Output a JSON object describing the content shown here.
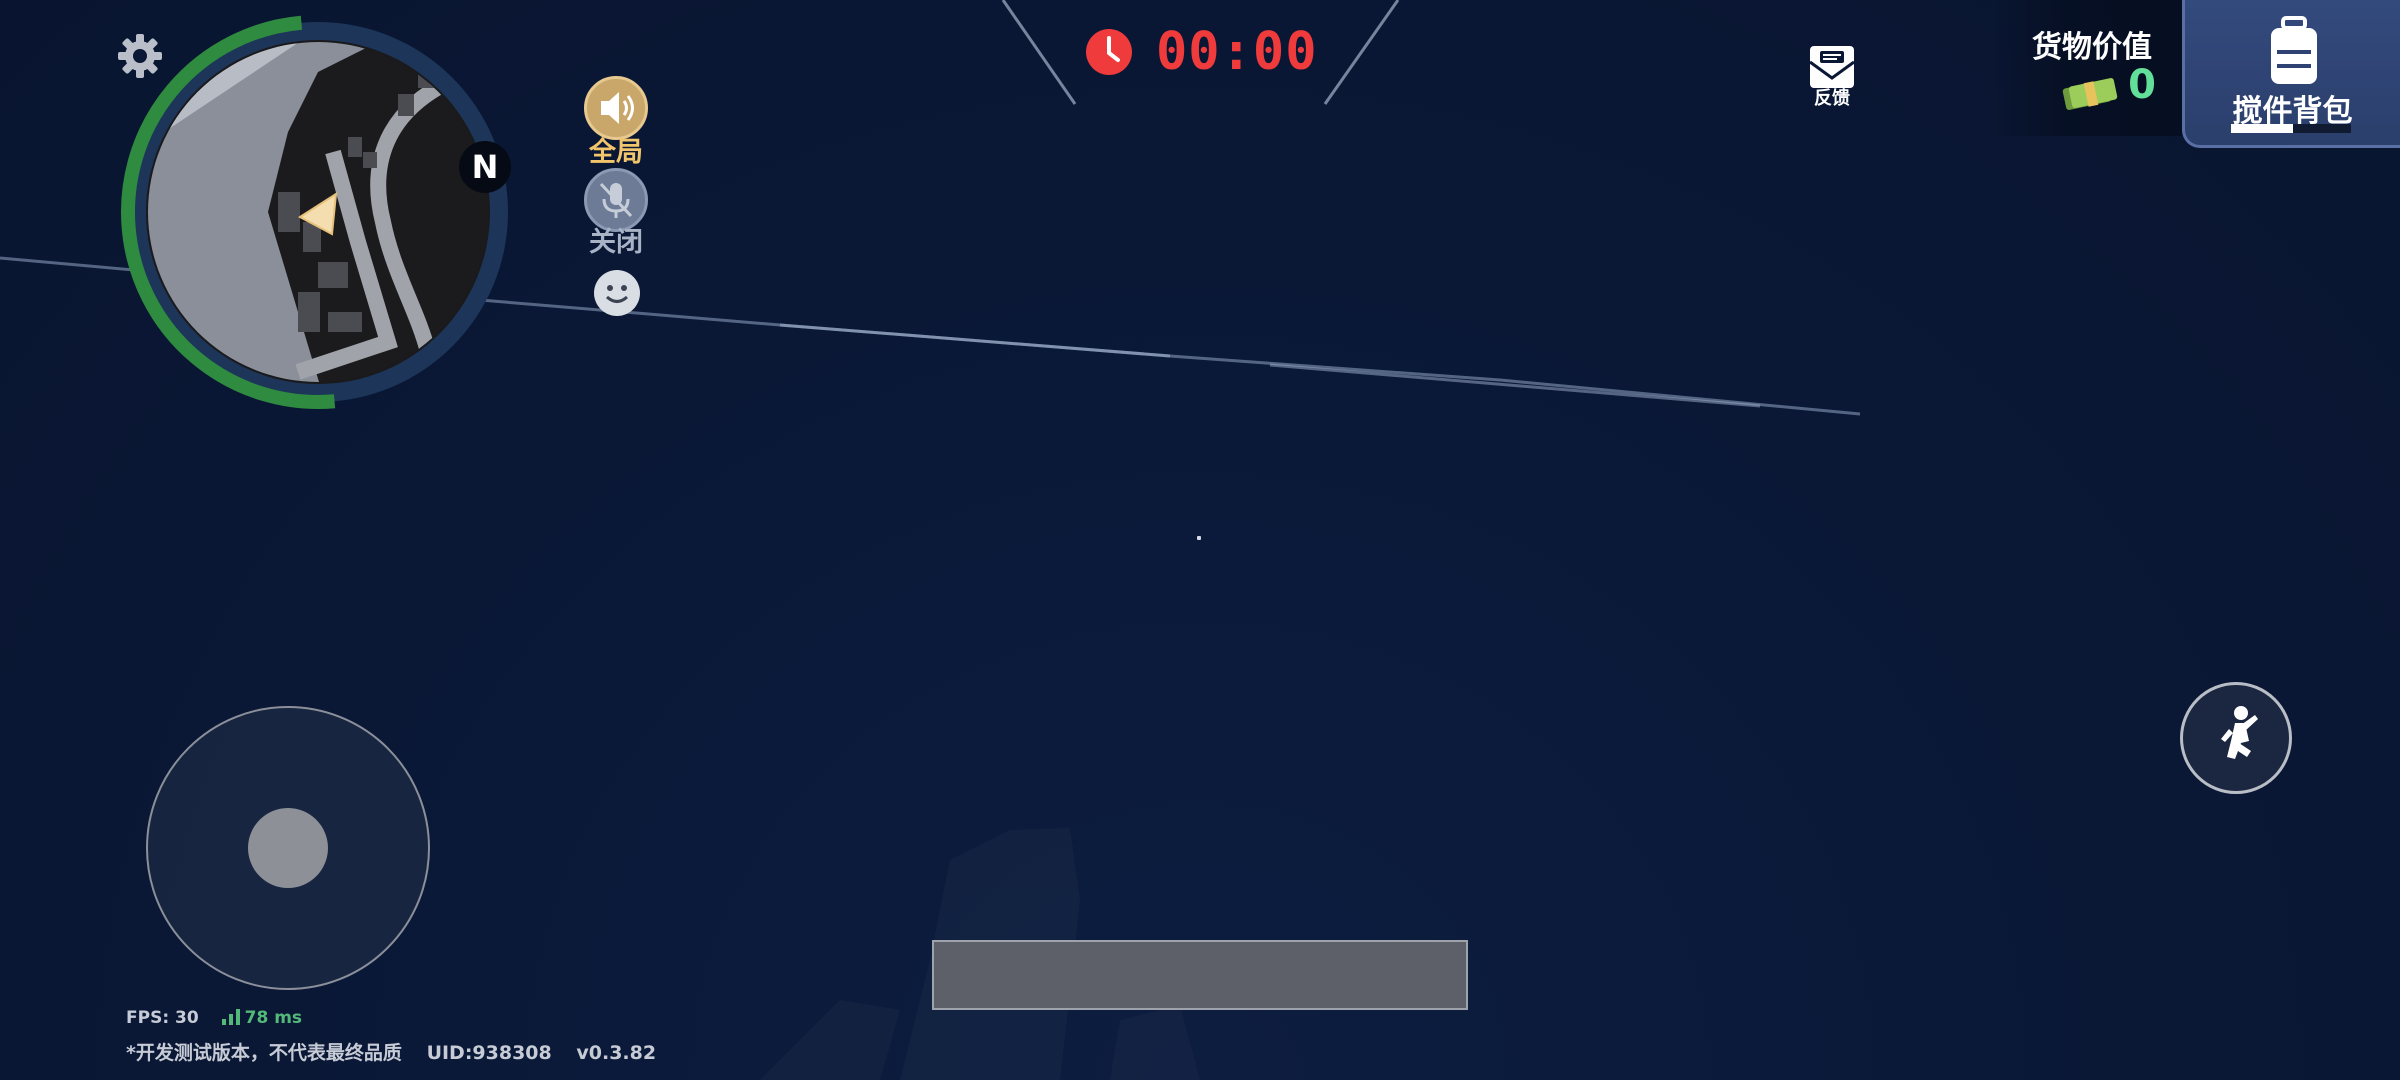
{
  "timer": {
    "value": "00:00",
    "color": "#ef3b3b",
    "icon": "clock-icon"
  },
  "minimap": {
    "north_label": "N",
    "health_ring_color": "#2e8b3f",
    "ring_color": "#1c3558",
    "player_icon": "player-arrow-icon"
  },
  "voice": {
    "global_label": "全局",
    "mic_label": "关闭",
    "global_icon": "speaker-icon",
    "mic_icon": "mic-muted-icon",
    "emote_icon": "smiley-icon"
  },
  "feedback": {
    "label": "反馈",
    "icon": "envelope-icon"
  },
  "cargo": {
    "label": "货物价值",
    "value": "0",
    "icon": "cash-icon",
    "value_color": "#62e09a"
  },
  "backpack": {
    "label": "搅件背包",
    "icon": "backpack-icon",
    "capacity_fraction": 0.52
  },
  "controls": {
    "joystick": "joystick",
    "jump_icon": "jump-icon",
    "chat_value": ""
  },
  "stats": {
    "fps": "FPS: 30",
    "ping": "78 ms"
  },
  "build": {
    "notice": "*开发测试版本，不代表最终品质",
    "uid": "UID:938308",
    "version": "v0.3.82"
  },
  "settings": {
    "icon": "gear-icon"
  }
}
